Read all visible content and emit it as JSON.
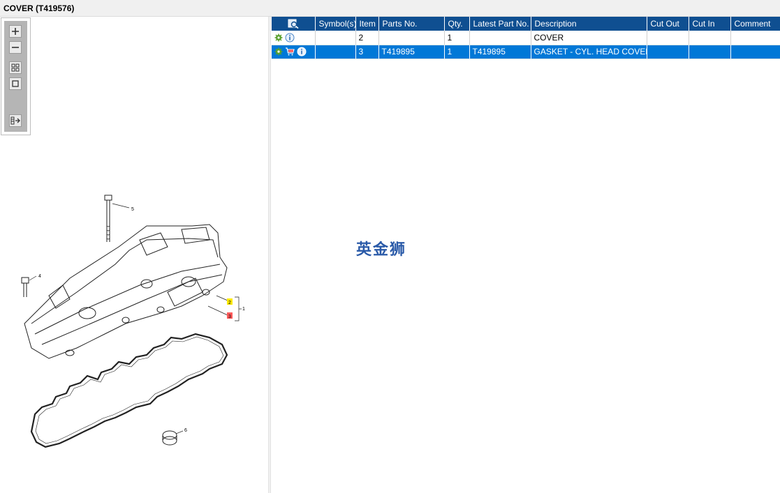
{
  "window": {
    "title": "COVER (T419576)"
  },
  "toolbox": {
    "buttons": [
      "zoom-in",
      "zoom-out",
      "fit-all",
      "actual-size",
      "toggle-list"
    ]
  },
  "drawing": {
    "callouts": {
      "c1": "1",
      "c2": "2",
      "c3": "3",
      "c4": "4",
      "c5": "5",
      "c6": "6"
    },
    "highlight_colors": {
      "item2": "#ffeb00",
      "item3": "#ff5a5a"
    }
  },
  "table": {
    "columns": {
      "symbols": "Symbol(s)",
      "item": "Item",
      "parts_no": "Parts No.",
      "qty": "Qty.",
      "latest_part_no": "Latest Part No.",
      "description": "Description",
      "cut_out": "Cut Out",
      "cut_in": "Cut In",
      "comment": "Comment"
    },
    "rows": [
      {
        "item": "2",
        "parts_no": "",
        "qty": "1",
        "latest_part_no": "",
        "description": "COVER",
        "cut_out": "",
        "cut_in": "",
        "comment": "",
        "icons": [
          "gear-icon",
          "info-icon"
        ],
        "selected": false
      },
      {
        "item": "3",
        "parts_no": "T419895",
        "qty": "1",
        "latest_part_no": "T419895",
        "description": "GASKET - CYL. HEAD COVER",
        "cut_out": "",
        "cut_in": "",
        "comment": "",
        "icons": [
          "gear-icon",
          "cart-icon",
          "info-icon"
        ],
        "selected": true
      }
    ]
  },
  "watermark": "英金狮",
  "colors": {
    "header_bg": "#0f4f91",
    "selected_row": "#0078d7",
    "gear": "#5aa02c"
  }
}
